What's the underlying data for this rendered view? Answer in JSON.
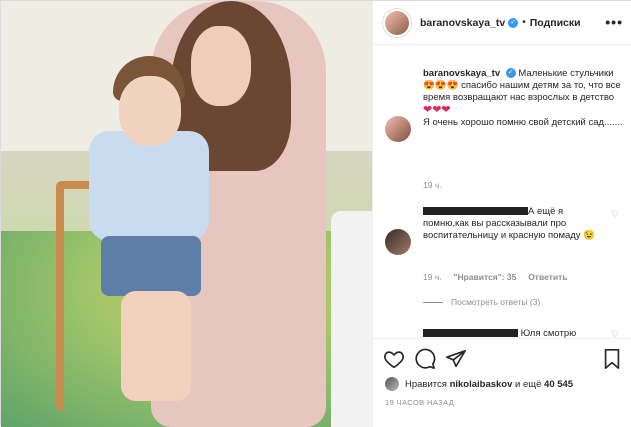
{
  "header": {
    "username": "baranovskaya_tv",
    "verified_icon": "verified-badge-icon",
    "separator": "•",
    "follow_label": "Подписки",
    "more_label": "•••"
  },
  "caption": {
    "username": "baranovskaya_tv",
    "text_1": "Маленькие стульчики",
    "emojis": "😍😍😍",
    "text_2": "спасибо нашим детям за то, что все время возвращают нас взрослых в детство",
    "hearts": "❤❤❤",
    "text_3": "Я очень хорошо помню свой детский сад.......",
    "time": "19 ч."
  },
  "comment_1": {
    "text": "А ещё я помню,как вы рассказывали про воспитательницу и красную помаду",
    "emoji": "😉",
    "time": "19 ч.",
    "likes": "\"Нравится\": 35",
    "reply_label": "Ответить",
    "see_replies": "Посмотреть ответы (3)"
  },
  "comment_2": {
    "text": "Юля смотрю"
  },
  "likes": {
    "prefix": "Нравится",
    "user": "nikolaibaskov",
    "suffix": "и ещё",
    "count": "40 545"
  },
  "timestamp": "19 ЧАСОВ НАЗАД",
  "colors": {
    "verified": "#3897f0",
    "muted": "#8e8e8e",
    "text": "#262626",
    "heart": "#e0245e"
  }
}
